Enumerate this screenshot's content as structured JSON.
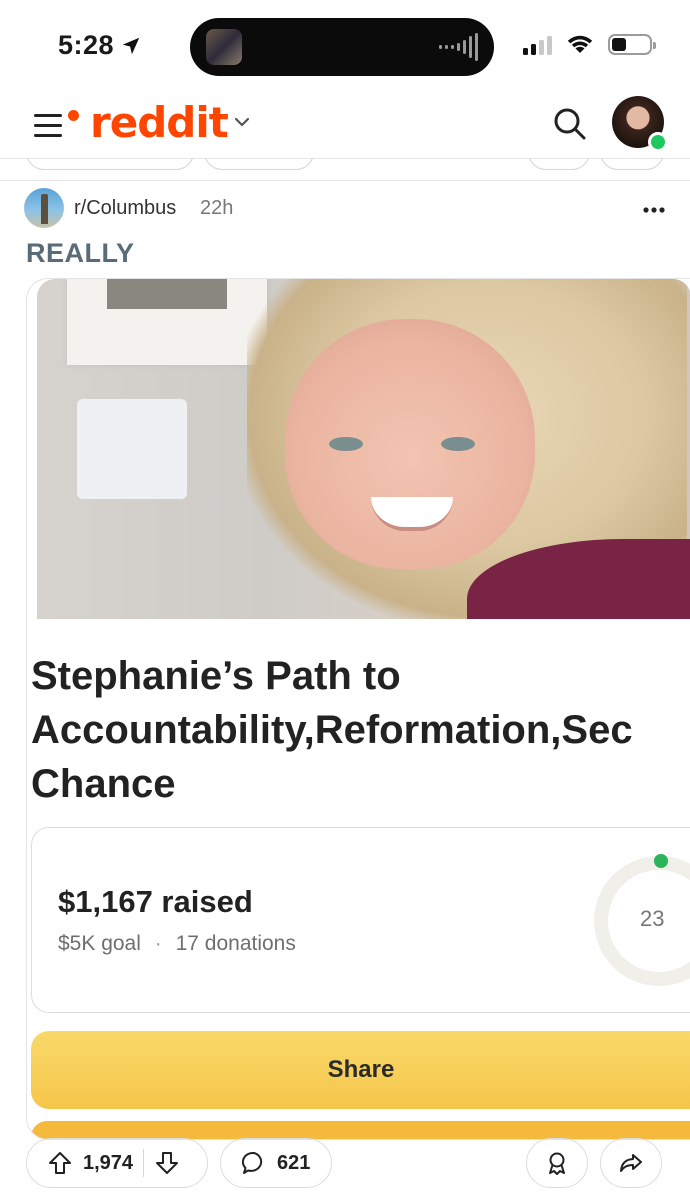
{
  "status_bar": {
    "time": "5:28"
  },
  "header": {
    "logo": "reddit"
  },
  "post": {
    "subreddit": "r/Columbus",
    "age": "22h",
    "title": "REALLY",
    "card": {
      "title_line1": "Stephanie’s Path to",
      "title_line2": "Accountability,Reformation,Sec",
      "title_line3": "Chance",
      "raised": "$1,167 raised",
      "goal": "$5K goal",
      "donations": "17 donations",
      "progress_percent": 23,
      "progress_label": "23",
      "share_label": "Share"
    },
    "upvotes": "1,974",
    "comments": "621"
  },
  "colors": {
    "brand": "#ff4500",
    "online": "#1ec85e",
    "share": "#f5c64a",
    "progress": "#2cb45a"
  }
}
